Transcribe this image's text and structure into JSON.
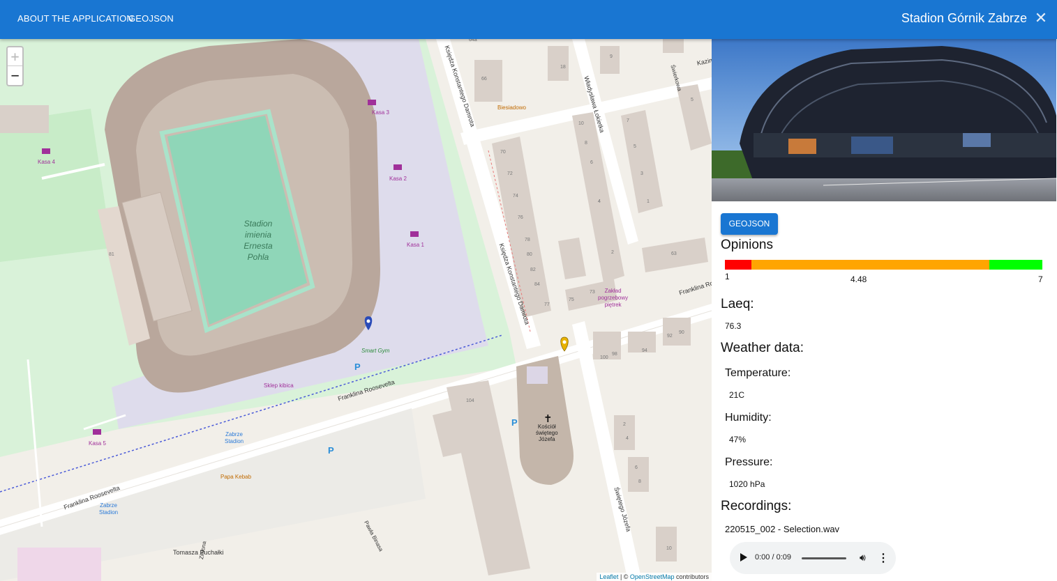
{
  "appbar": {
    "nav": [
      "ABOUT THE APPLICATION",
      "GEOJSON"
    ],
    "title": "Stadion Górnik Zabrze",
    "close_icon": "close-icon"
  },
  "map": {
    "zoom_in": "+",
    "zoom_out": "−",
    "labels": {
      "stadium": [
        "Stadion",
        "imienia",
        "Ernesta",
        "Pohla"
      ],
      "kasa1": "Kasa 1",
      "kasa2": "Kasa 2",
      "kasa3": "Kasa 3",
      "kasa4": "Kasa 4",
      "kasa5": "Kasa 5",
      "smart_gym": "Smart Gym",
      "sklep": "Sklep kibica",
      "zabrze_stadion": [
        "Zabrze",
        "Stadion"
      ],
      "papa_kebab": "Papa Kebab",
      "biesiadowo": "Biesiadowo",
      "kosciol": [
        "Kościół",
        "świętego",
        "Józefa"
      ],
      "zaklad": [
        "Zakład",
        "pogrzebowy",
        "piętrek"
      ],
      "streets": {
        "franklina1": "Franklina Roosevelta",
        "franklina2": "Franklina Roosevelta",
        "franklina3": "Franklina Ro",
        "damrota1": "Księdza Konstantego Damrota",
        "damrota2": "Księdza Konstantego Damrota",
        "lokietka": "Władysława Łokietka",
        "swierkowa": "Świerkowa",
        "kazim": "Kazim",
        "puchalki": "Tomasza Puchałki",
        "zielona": "Zielona",
        "binasa": "Pawła Binasa",
        "jozefa": "Świętego Józefa"
      },
      "house_numbers": [
        "64a",
        "66",
        "18",
        "9",
        "70",
        "72",
        "74",
        "76",
        "78",
        "80",
        "82",
        "84",
        "77",
        "75",
        "73",
        "10",
        "8",
        "6",
        "4",
        "2",
        "7",
        "5",
        "3",
        "1",
        "63",
        "92",
        "90",
        "94",
        "100",
        "98",
        "104",
        "81",
        "2",
        "4",
        "6",
        "8",
        "10",
        "5",
        "4"
      ]
    },
    "attribution": {
      "leaflet": "Leaflet",
      "sep": " | © ",
      "osm": "OpenStreetMap",
      "tail": " contributors"
    }
  },
  "panel": {
    "geojson_button": "GEOJSON",
    "opinions": {
      "heading": "Opinions",
      "min": "1",
      "avg": "4.48",
      "max": "7",
      "segments": [
        {
          "color": "#ff0000",
          "from": 1.0,
          "to": 1.5
        },
        {
          "color": "#ffa500",
          "from": 1.5,
          "to": 6.0
        },
        {
          "color": "#00ff00",
          "from": 6.0,
          "to": 7.0
        }
      ]
    },
    "laeq": {
      "heading": "Laeq:",
      "value": "76.3"
    },
    "weather": {
      "heading": "Weather data:",
      "temperature_label": "Temperature:",
      "temperature_value": "21C",
      "humidity_label": "Humidity:",
      "humidity_value": "47%",
      "pressure_label": "Pressure:",
      "pressure_value": "1020 hPa"
    },
    "recordings": {
      "heading": "Recordings:",
      "file": "220515_002 - Selection.wav",
      "player": {
        "time": "0:00 / 0:09",
        "progress": 0.0,
        "play_icon": "play-icon",
        "volume_icon": "volume-icon",
        "more_icon": "more-vert-icon"
      }
    }
  }
}
